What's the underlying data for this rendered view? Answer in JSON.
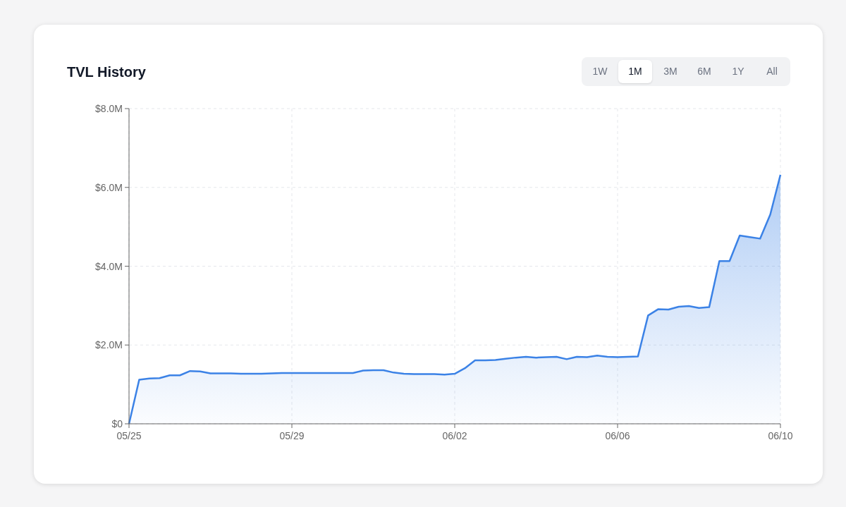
{
  "card": {
    "title": "TVL History",
    "ranges": [
      {
        "label": "1W",
        "selected": false
      },
      {
        "label": "1M",
        "selected": true
      },
      {
        "label": "3M",
        "selected": false
      },
      {
        "label": "6M",
        "selected": false
      },
      {
        "label": "1Y",
        "selected": false
      },
      {
        "label": "All",
        "selected": false
      }
    ],
    "chart_data": {
      "type": "area",
      "categories": [
        "05/25",
        null,
        null,
        null,
        null,
        null,
        null,
        null,
        null,
        null,
        null,
        null,
        null,
        null,
        null,
        null,
        "05/29",
        null,
        null,
        null,
        null,
        null,
        null,
        null,
        null,
        null,
        null,
        null,
        null,
        null,
        null,
        null,
        "06/02",
        null,
        null,
        null,
        null,
        null,
        null,
        null,
        null,
        null,
        null,
        null,
        null,
        null,
        null,
        null,
        "06/06",
        null,
        null,
        null,
        null,
        null,
        null,
        null,
        null,
        null,
        null,
        null,
        null,
        null,
        null,
        null,
        "06/10"
      ],
      "series": [
        {
          "color": "#3b82e6",
          "values": [
            0,
            1.12,
            1.15,
            1.16,
            1.23,
            1.23,
            1.34,
            1.33,
            1.28,
            1.28,
            1.28,
            1.27,
            1.27,
            1.27,
            1.28,
            1.29,
            1.29,
            1.29,
            1.29,
            1.29,
            1.29,
            1.29,
            1.29,
            1.35,
            1.36,
            1.36,
            1.3,
            1.27,
            1.26,
            1.26,
            1.26,
            1.25,
            1.27,
            1.41,
            1.61,
            1.61,
            1.62,
            1.65,
            1.68,
            1.7,
            1.68,
            1.69,
            1.7,
            1.64,
            1.7,
            1.69,
            1.73,
            1.7,
            1.69,
            1.7,
            1.71,
            2.75,
            2.91,
            2.9,
            2.97,
            2.99,
            2.94,
            2.96,
            4.13,
            4.13,
            4.78,
            4.74,
            4.7,
            5.31,
            6.32
          ]
        }
      ],
      "grid": true,
      "ylim": [
        0,
        8
      ],
      "yticks": [
        {
          "value": 0,
          "label": "$0"
        },
        {
          "value": 2,
          "label": "$2.0M"
        },
        {
          "value": 4,
          "label": "$4.0M"
        },
        {
          "value": 6,
          "label": "$6.0M"
        },
        {
          "value": 8,
          "label": "$8.0M"
        }
      ]
    }
  }
}
